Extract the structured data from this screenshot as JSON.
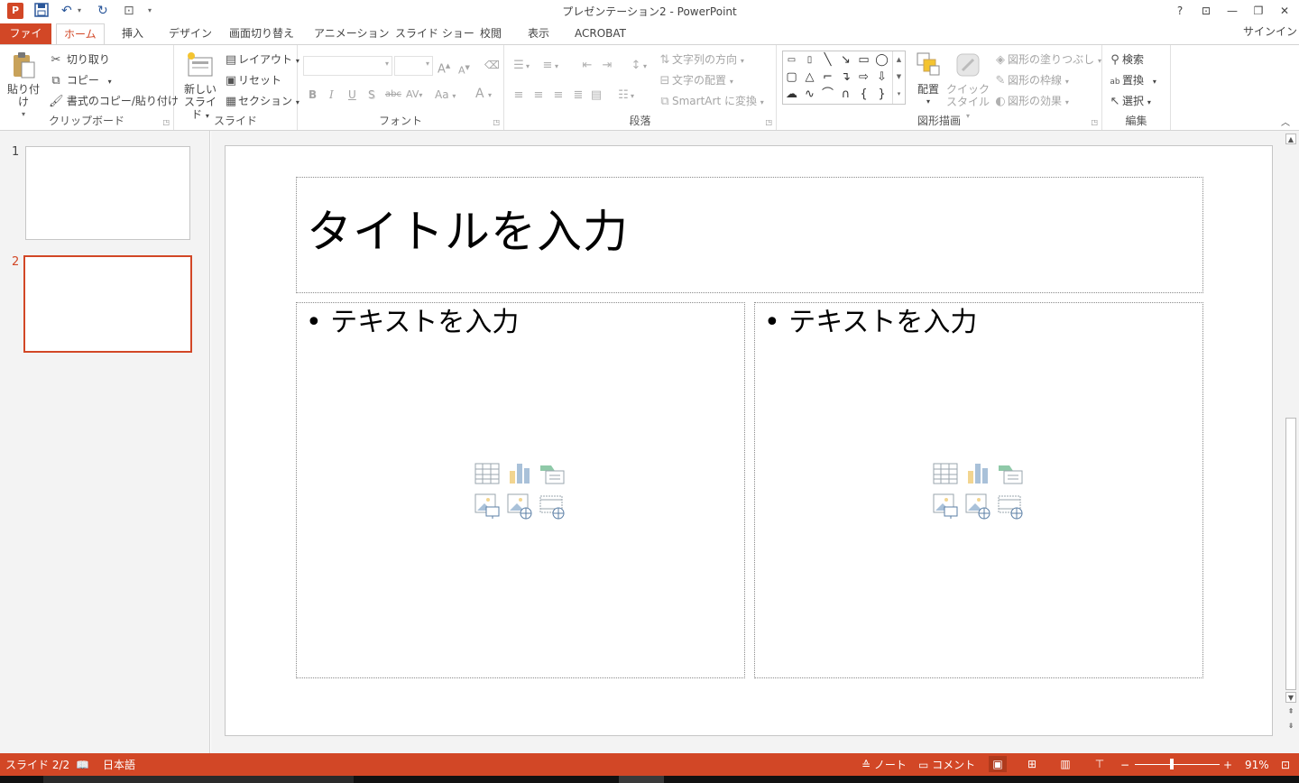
{
  "window": {
    "title": "プレゼンテーション2 - PowerPoint",
    "app_icon_letter": "P",
    "help": "?",
    "ribbon_display": "⊡",
    "minimize": "—",
    "restore": "❐",
    "close": "✕"
  },
  "tabs": {
    "file": "ファイル",
    "items": [
      "ホーム",
      "挿入",
      "デザイン",
      "画面切り替え",
      "アニメーション",
      "スライド ショー",
      "校閲",
      "表示",
      "ACROBAT"
    ],
    "signin": "サインイン"
  },
  "ribbon": {
    "clipboard": {
      "label": "クリップボード",
      "paste": "貼り付け",
      "cut": "切り取り",
      "copy": "コピー",
      "format_painter": "書式のコピー/貼り付け"
    },
    "slides": {
      "label": "スライド",
      "new_slide_line1": "新しい",
      "new_slide_line2": "スライド",
      "layout": "レイアウト",
      "reset": "リセット",
      "section": "セクション"
    },
    "font": {
      "label": "フォント",
      "bold": "B",
      "italic": "I",
      "underline": "U",
      "shadow": "S",
      "strike": "abc",
      "spacing": "AV",
      "case": "Aa",
      "color": "A",
      "grow": "A",
      "shrink": "A"
    },
    "paragraph": {
      "label": "段落",
      "text_direction": "文字列の方向",
      "align_text": "文字の配置",
      "smartart": "SmartArt に変換"
    },
    "drawing": {
      "label": "図形描画",
      "arrange": "配置",
      "quick_styles_line1": "クイック",
      "quick_styles_line2": "スタイル",
      "shape_fill": "図形の塗りつぶし",
      "shape_outline": "図形の枠線",
      "shape_effects": "図形の効果"
    },
    "editing": {
      "label": "編集",
      "find": "検索",
      "replace": "置換",
      "select": "選択"
    }
  },
  "thumbnails": [
    {
      "number": "1",
      "selected": false
    },
    {
      "number": "2",
      "selected": true
    }
  ],
  "slide": {
    "title_placeholder": "タイトルを入力",
    "left_text": "テキストを入力",
    "right_text": "テキストを入力",
    "bullet": "•"
  },
  "status": {
    "slide_info": "スライド 2/2",
    "language": "日本語",
    "notes": "ノート",
    "comments": "コメント",
    "zoom": "91%",
    "zoom_out": "−",
    "zoom_in": "+"
  },
  "colors": {
    "accent": "#d24726",
    "status_bar": "#d24726",
    "pane_bg": "#f3f3f3"
  }
}
